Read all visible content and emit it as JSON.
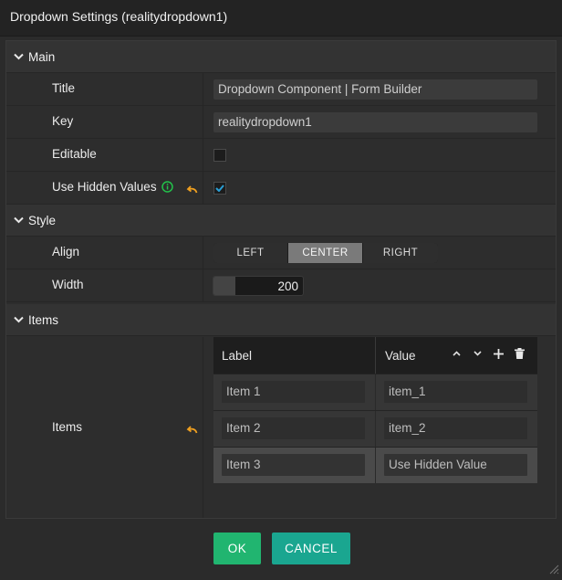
{
  "dialog": {
    "title": "Dropdown Settings (realitydropdown1)"
  },
  "sections": {
    "main": "Main",
    "style": "Style",
    "items": "Items"
  },
  "fields": {
    "title": {
      "label": "Title",
      "value": "Dropdown Component | Form Builder"
    },
    "key": {
      "label": "Key",
      "value": "realitydropdown1"
    },
    "editable": {
      "label": "Editable",
      "checked": false
    },
    "use_hidden_values": {
      "label": "Use Hidden Values",
      "checked": true
    },
    "align": {
      "label": "Align",
      "options": [
        "LEFT",
        "CENTER",
        "RIGHT"
      ],
      "selected": "CENTER"
    },
    "width": {
      "label": "Width",
      "value": "200"
    },
    "items": {
      "label": "Items"
    }
  },
  "items_table": {
    "columns": [
      "Label",
      "Value"
    ],
    "rows": [
      {
        "label": "Item 1",
        "value": "item_1"
      },
      {
        "label": "Item 2",
        "value": "item_2"
      },
      {
        "label": "Item 3",
        "value": "Use Hidden Value"
      }
    ],
    "selected_row": 2
  },
  "buttons": {
    "ok": "OK",
    "cancel": "CANCEL"
  },
  "colors": {
    "ok": "#21b570",
    "cancel": "#1aa690",
    "undo_icon": "#f0a020",
    "info_icon": "#22c24a",
    "check": "#2a9fd6"
  },
  "icons": [
    "chevron-down-icon",
    "info-icon",
    "undo-icon",
    "checkmark-icon",
    "move-up-icon",
    "move-down-icon",
    "add-icon",
    "trash-icon",
    "resize-grip-icon"
  ]
}
